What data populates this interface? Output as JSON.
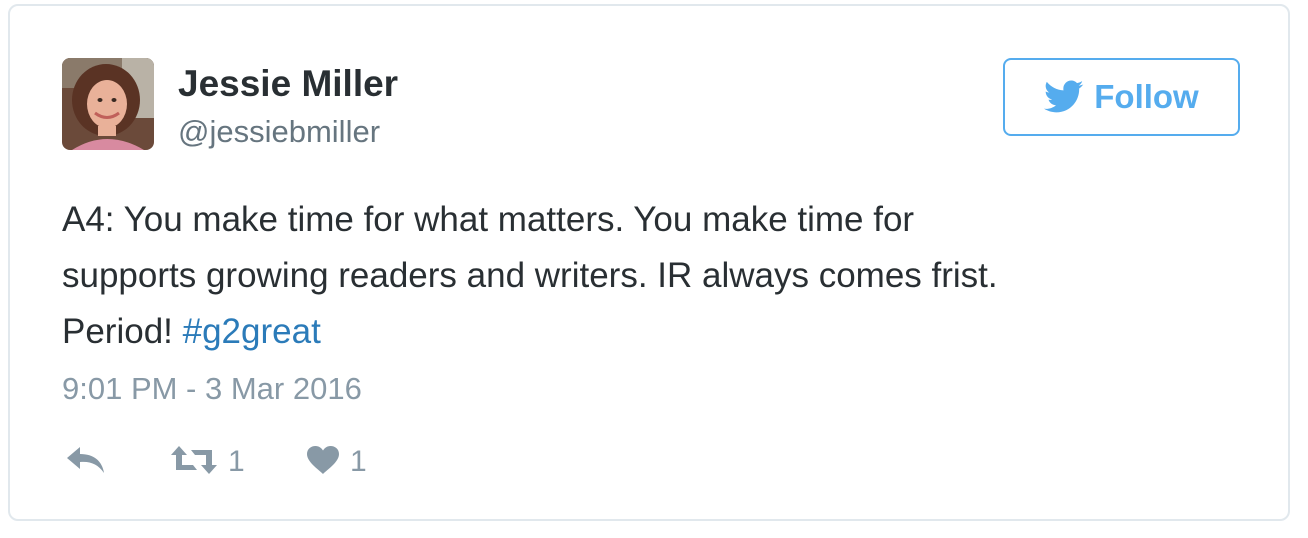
{
  "author": {
    "name": "Jessie Miller",
    "handle": "@jessiebmiller"
  },
  "follow_button": {
    "label": "Follow",
    "icon": "twitter-bird-icon",
    "color": "#55acee"
  },
  "tweet": {
    "lines": [
      "A4: You make time for what matters. You make time for",
      "supports growing readers and writers. IR always comes frist.",
      "Period! "
    ],
    "hashtag": "#g2great",
    "timestamp": "9:01 PM - 3 Mar 2016"
  },
  "actions": {
    "reply": {
      "icon": "reply-icon"
    },
    "retweet": {
      "icon": "retweet-icon",
      "count": "1"
    },
    "like": {
      "icon": "heart-icon",
      "count": "1"
    }
  },
  "colors": {
    "text": "#292f33",
    "muted": "#8899a6",
    "link": "#2b7bb9",
    "border": "#e1e8ed"
  }
}
